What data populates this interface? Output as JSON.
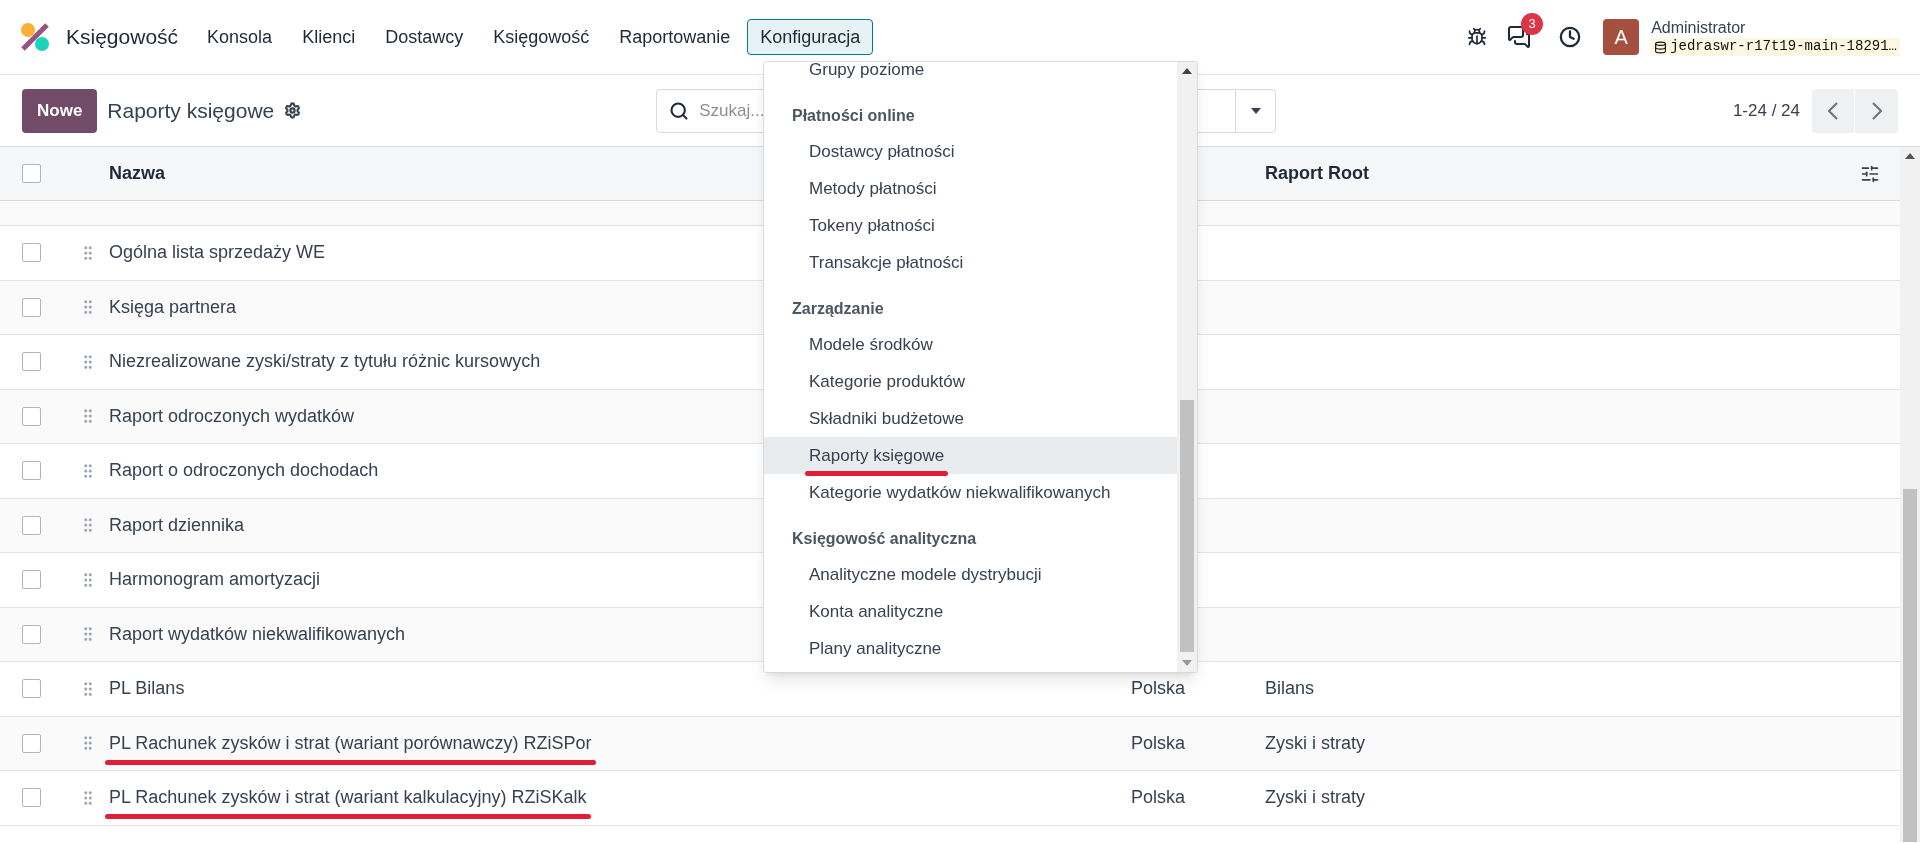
{
  "app": {
    "name": "Księgowość"
  },
  "nav": [
    {
      "label": "Konsola",
      "selected": false
    },
    {
      "label": "Klienci",
      "selected": false
    },
    {
      "label": "Dostawcy",
      "selected": false
    },
    {
      "label": "Księgowość",
      "selected": false
    },
    {
      "label": "Raportowanie",
      "selected": false
    },
    {
      "label": "Konfiguracja",
      "selected": true
    }
  ],
  "systray": {
    "message_count": "3",
    "avatar_letter": "A",
    "user": "Administrator",
    "database": "jedraswr-r17t19-main-18291…"
  },
  "control_panel": {
    "new_button": "Nowe",
    "title": "Raporty księgowe",
    "search": {
      "placeholder": "Szukaj..."
    },
    "pager": "1-24 / 24"
  },
  "table": {
    "header_checked": false,
    "columns": [
      {
        "label": "Nazwa"
      },
      {
        "label": "Raport Root"
      }
    ],
    "rows": [
      {
        "name": "Ogólna lista sprzedaży WE",
        "checked": false,
        "underlined": false
      },
      {
        "name": "Księga partnera",
        "checked": false,
        "underlined": false
      },
      {
        "name": "Niezrealizowane zyski/straty z tytułu różnic kursowych",
        "checked": false,
        "underlined": false
      },
      {
        "name": "Raport odroczonych wydatków",
        "checked": false,
        "underlined": false
      },
      {
        "name": "Raport o odroczonych dochodach",
        "checked": false,
        "underlined": false
      },
      {
        "name": "Raport dziennika",
        "checked": false,
        "underlined": false
      },
      {
        "name": "Harmonogram amortyzacji",
        "checked": false,
        "underlined": false
      },
      {
        "name": "Raport wydatków niekwalifikowanych",
        "checked": false,
        "underlined": false
      },
      {
        "name": "PL Bilans",
        "country": "Polska",
        "root": "Bilans",
        "checked": false,
        "underlined": false
      },
      {
        "name": "PL Rachunek zysków i strat (wariant porównawczy) RZiSPor",
        "country": "Polska",
        "root": "Zyski i straty",
        "checked": false,
        "underlined": true
      },
      {
        "name": "PL Rachunek zysków i strat (wariant kalkulacyjny) RZiSKalk",
        "country": "Polska",
        "root": "Zyski i straty",
        "checked": false,
        "underlined": true
      }
    ]
  },
  "menu": {
    "items": [
      {
        "kind": "item",
        "label": "Grupy poziome",
        "selected": false,
        "underlined": false
      },
      {
        "kind": "header",
        "label": "Płatności online"
      },
      {
        "kind": "item",
        "label": "Dostawcy płatności",
        "selected": false,
        "underlined": false
      },
      {
        "kind": "item",
        "label": "Metody płatności",
        "selected": false,
        "underlined": false
      },
      {
        "kind": "item",
        "label": "Tokeny płatności",
        "selected": false,
        "underlined": false
      },
      {
        "kind": "item",
        "label": "Transakcje płatności",
        "selected": false,
        "underlined": false
      },
      {
        "kind": "header",
        "label": "Zarządzanie"
      },
      {
        "kind": "item",
        "label": "Modele środków",
        "selected": false,
        "underlined": false
      },
      {
        "kind": "item",
        "label": "Kategorie produktów",
        "selected": false,
        "underlined": false
      },
      {
        "kind": "item",
        "label": "Składniki budżetowe",
        "selected": false,
        "underlined": false
      },
      {
        "kind": "item",
        "label": "Raporty księgowe",
        "selected": true,
        "underlined": true
      },
      {
        "kind": "item",
        "label": "Kategorie wydatków niekwalifikowanych",
        "selected": false,
        "underlined": false
      },
      {
        "kind": "header",
        "label": "Księgowość analityczna"
      },
      {
        "kind": "item",
        "label": "Analityczne modele dystrybucji",
        "selected": false,
        "underlined": false
      },
      {
        "kind": "item",
        "label": "Konta analityczne",
        "selected": false,
        "underlined": false
      },
      {
        "kind": "item",
        "label": "Plany analityczne",
        "selected": false,
        "underlined": false
      }
    ]
  }
}
